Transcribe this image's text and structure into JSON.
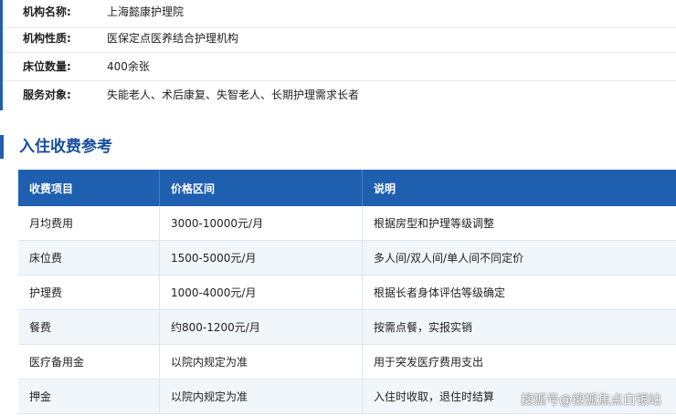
{
  "info": [
    {
      "label": "机构名称:",
      "value": "上海懿康护理院"
    },
    {
      "label": "机构性质:",
      "value": "医保定点医养结合护理机构"
    },
    {
      "label": "床位数量:",
      "value": "400余张"
    },
    {
      "label": "服务对象:",
      "value": "失能老人、术后康复、失智老人、长期护理需求长者"
    }
  ],
  "section": {
    "title": "入住收费参考"
  },
  "fee_table": {
    "headers": [
      "收费项目",
      "价格区间",
      "说明"
    ],
    "rows": [
      [
        "月均费用",
        "3000-10000元/月",
        "根据房型和护理等级调整"
      ],
      [
        "床位费",
        "1500-5000元/月",
        "多人间/双人间/单人间不同定价"
      ],
      [
        "护理费",
        "1000-4000元/月",
        "根据长者身体评估等级确定"
      ],
      [
        "餐费",
        "约800-1200元/月",
        "按需点餐，实报实销"
      ],
      [
        "医疗备用金",
        "以院内规定为准",
        "用于突发医疗费用支出"
      ],
      [
        "押金",
        "以院内规定为准",
        "入住时收取，退住时结算"
      ]
    ]
  },
  "watermark": "搜狐号@搜狐焦点白银站",
  "colors": {
    "accent": "#1f5fb0",
    "title": "#1a4f9c",
    "row_alt": "#f1f6fb"
  }
}
